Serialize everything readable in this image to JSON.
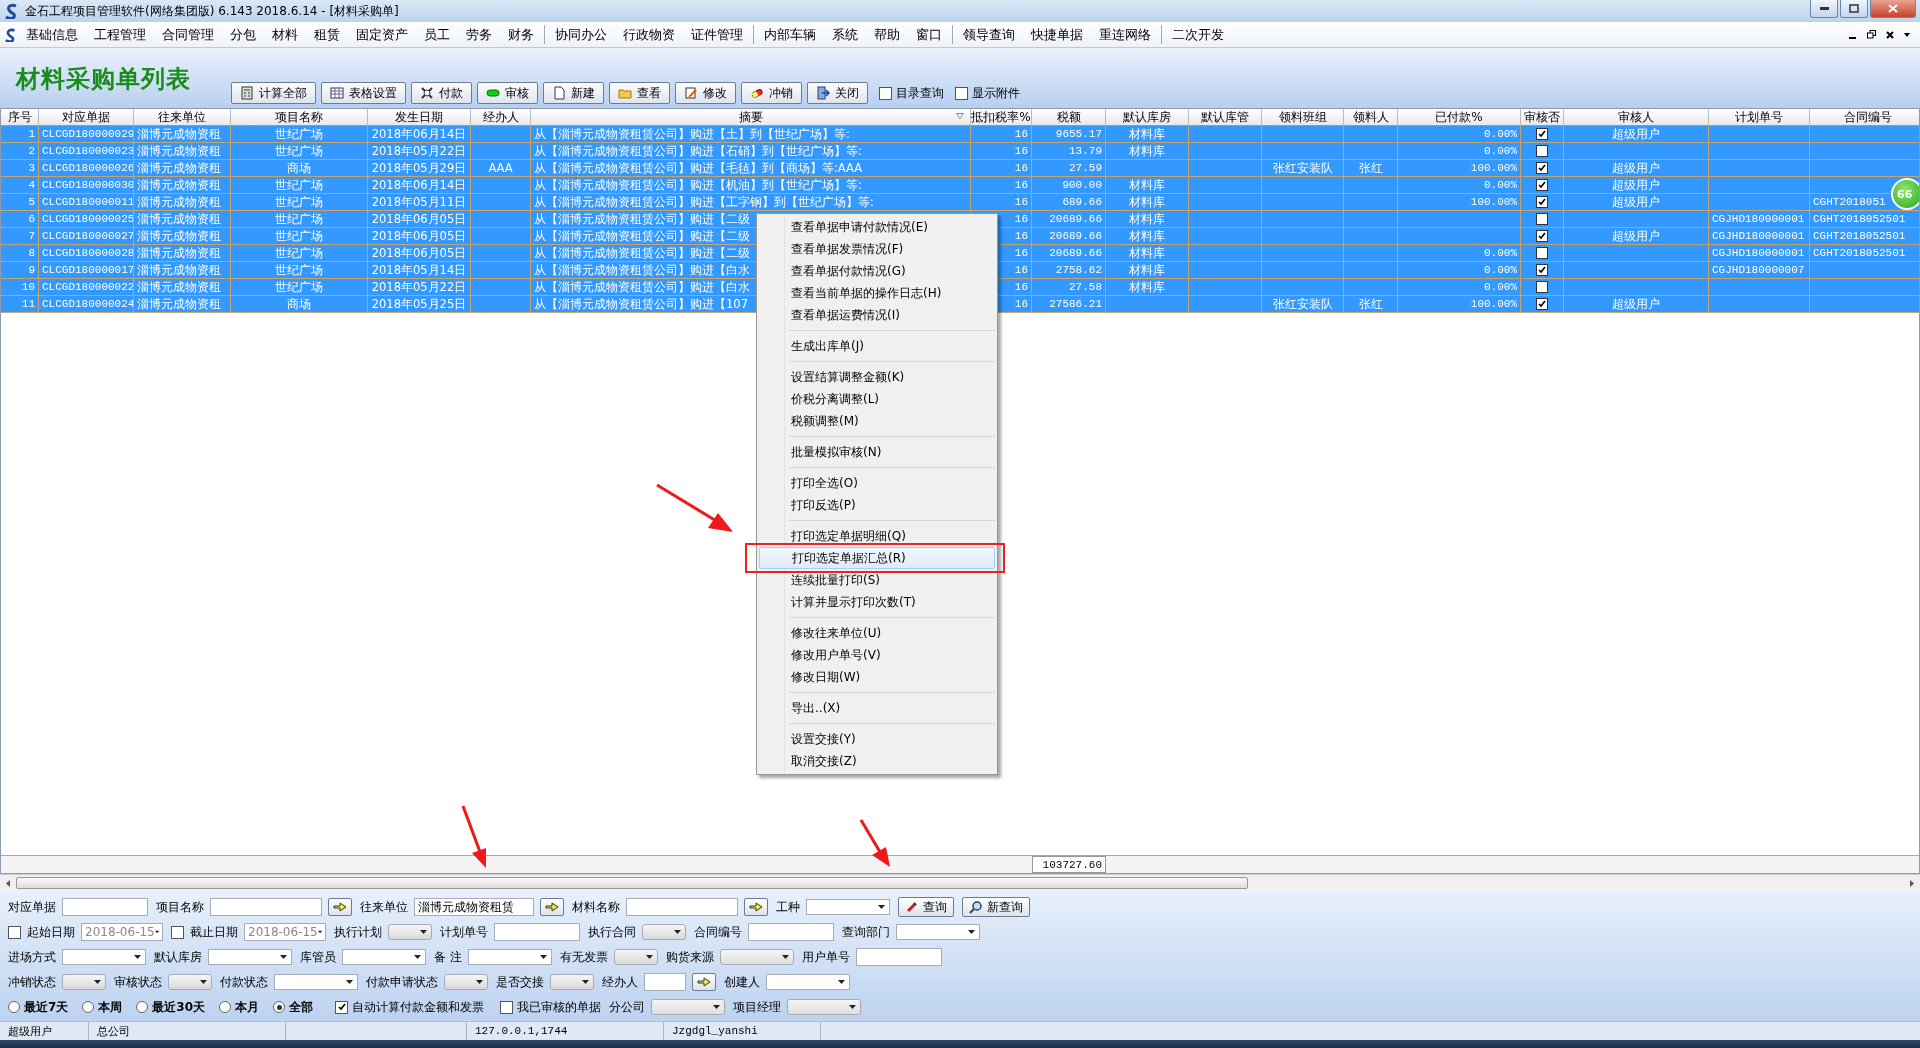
{
  "window": {
    "title": "金石工程项目管理软件(网络集团版) 6.143  2018.6.14 - [材料采购单]"
  },
  "menu_groups": [
    [
      "基础信息",
      "工程管理",
      "合同管理",
      "分包",
      "材料",
      "租赁",
      "固定资产",
      "员工",
      "劳务",
      "财务"
    ],
    [
      "协同办公",
      "行政物资",
      "证件管理"
    ],
    [
      "内部车辆",
      "系统",
      "帮助",
      "窗口"
    ],
    [
      "领导查询",
      "快捷单据",
      "重连网络"
    ],
    [
      "二次开发"
    ]
  ],
  "page_title": "材料采购单列表",
  "toolbar": [
    {
      "label": "计算全部"
    },
    {
      "label": "表格设置"
    },
    {
      "label": "付款"
    },
    {
      "label": "审核"
    },
    {
      "label": "新建"
    },
    {
      "label": "查看"
    },
    {
      "label": "修改"
    },
    {
      "label": "冲销"
    },
    {
      "label": "关闭"
    }
  ],
  "toolbar_checks": [
    {
      "label": "目录查询",
      "checked": false
    },
    {
      "label": "显示附件",
      "checked": false
    }
  ],
  "table": {
    "columns": [
      "序号",
      "对应单据",
      "往来单位",
      "项目名称",
      "发生日期",
      "经办人",
      "摘要",
      "抵扣税率%",
      "税额",
      "默认库房",
      "默认库管",
      "领料班组",
      "领料人",
      "已付款%",
      "审核否",
      "审核人",
      "计划单号",
      "合同编号"
    ],
    "rows": [
      {
        "no": "1",
        "doc": "CLCGD180000029",
        "partner": "淄博元成物资租",
        "project": "世纪广场",
        "date": "2018年06月14日",
        "summary": "从【淄博元成物资租赁公司】购进【土】到【世纪广场】等:",
        "rate": "16",
        "tax": "9655.17",
        "warehouse": "材料库",
        "paid": "0.00%",
        "approved": true,
        "approver": "超级用户",
        "selected": true
      },
      {
        "no": "2",
        "doc": "CLCGD180000023",
        "partner": "淄博元成物资租",
        "project": "世纪广场",
        "date": "2018年05月22日",
        "summary": "从【淄博元成物资租赁公司】购进【石硝】到【世纪广场】等:",
        "rate": "16",
        "tax": "13.79",
        "warehouse": "材料库",
        "paid": "0.00%",
        "approved": false,
        "selected": true
      },
      {
        "no": "3",
        "doc": "CLCGD180000026",
        "partner": "淄博元成物资租",
        "project": "商场",
        "date": "2018年05月29日",
        "handler": "AAA",
        "summary": "从【淄博元成物资租赁公司】购进【毛毡】到【商场】等:AAA",
        "rate": "16",
        "tax": "27.59",
        "team": "张红安装队",
        "receiver": "张红",
        "paid": "100.00%",
        "approved": true,
        "approver": "超级用户",
        "selected": true
      },
      {
        "no": "4",
        "doc": "CLCGD180000030",
        "partner": "淄博元成物资租",
        "project": "世纪广场",
        "date": "2018年06月14日",
        "summary": "从【淄博元成物资租赁公司】购进【机油】到【世纪广场】等:",
        "rate": "16",
        "tax": "900.00",
        "warehouse": "材料库",
        "paid": "0.00%",
        "approved": true,
        "approver": "超级用户",
        "selected": true
      },
      {
        "no": "5",
        "doc": "CLCGD180000011",
        "partner": "淄博元成物资租",
        "project": "世纪广场",
        "date": "2018年05月11日",
        "summary": "从【淄博元成物资租赁公司】购进【工字钢】到【世纪广场】等:",
        "rate": "16",
        "tax": "689.66",
        "warehouse": "材料库",
        "paid": "100.00%",
        "approved": true,
        "approver": "超级用户",
        "contract": "CGHT2018051",
        "selected": true
      },
      {
        "no": "6",
        "doc": "CLCGD180000025",
        "partner": "淄博元成物资租",
        "project": "世纪广场",
        "date": "2018年06月05日",
        "summary": "从【淄博元成物资租赁公司】购进【二级",
        "rate": "16",
        "tax": "20689.66",
        "warehouse": "材料库",
        "approved": false,
        "plan": "CGJHD180000001",
        "contract": "CGHT2018052501",
        "selected": true
      },
      {
        "no": "7",
        "doc": "CLCGD180000027",
        "partner": "淄博元成物资租",
        "project": "世纪广场",
        "date": "2018年06月05日",
        "summary": "从【淄博元成物资租赁公司】购进【二级",
        "rate": "16",
        "tax": "20689.66",
        "warehouse": "材料库",
        "approved": true,
        "approver": "超级用户",
        "plan": "CGJHD180000001",
        "contract": "CGHT2018052501",
        "selected": true
      },
      {
        "no": "8",
        "doc": "CLCGD180000028",
        "partner": "淄博元成物资租",
        "project": "世纪广场",
        "date": "2018年06月05日",
        "summary": "从【淄博元成物资租赁公司】购进【二级",
        "rate": "16",
        "tax": "20689.66",
        "warehouse": "材料库",
        "paid": "0.00%",
        "approved": false,
        "plan": "CGJHD180000001",
        "contract": "CGHT2018052501",
        "selected": true
      },
      {
        "no": "9",
        "doc": "CLCGD180000017",
        "partner": "淄博元成物资租",
        "project": "世纪广场",
        "date": "2018年05月14日",
        "summary": "从【淄博元成物资租赁公司】购进【白水",
        "rate": "16",
        "tax": "2758.62",
        "warehouse": "材料库",
        "paid": "0.00%",
        "approved": true,
        "plan": "CGJHD180000007",
        "selected": true
      },
      {
        "no": "10",
        "doc": "CLCGD180000022",
        "partner": "淄博元成物资租",
        "project": "世纪广场",
        "date": "2018年05月22日",
        "summary": "从【淄博元成物资租赁公司】购进【白水",
        "rate": "16",
        "tax": "27.58",
        "warehouse": "材料库",
        "paid": "0.00%",
        "approved": false,
        "selected": true
      },
      {
        "no": "11",
        "doc": "CLCGD180000024",
        "partner": "淄博元成物资租",
        "project": "商场",
        "date": "2018年05月25日",
        "summary": "从【淄博元成物资租赁公司】购进【107",
        "rate": "16",
        "tax": "27586.21",
        "team": "张红安装队",
        "receiver": "张红",
        "paid": "100.00%",
        "approved": true,
        "approver": "超级用户",
        "selected": true
      }
    ],
    "total_tax": "103727.60"
  },
  "floating_badge": "66",
  "context_menu": [
    [
      {
        "label": "查看单据申请付款情况(E)",
        "selected": false
      },
      {
        "label": "查看单据发票情况(F)",
        "selected": false
      },
      {
        "label": "查看单据付款情况(G)",
        "selected": false
      },
      {
        "label": "查看当前单据的操作日志(H)",
        "selected": false
      },
      {
        "label": "查看单据运费情况(I)",
        "selected": false
      }
    ],
    [
      {
        "label": "生成出库单(J)",
        "selected": false
      }
    ],
    [
      {
        "label": "设置结算调整金额(K)",
        "selected": false
      },
      {
        "label": "价税分离调整(L)",
        "selected": false
      },
      {
        "label": "税额调整(M)",
        "selected": false
      }
    ],
    [
      {
        "label": "批量模拟审核(N)",
        "selected": false
      }
    ],
    [
      {
        "label": "打印全选(O)",
        "selected": false
      },
      {
        "label": "打印反选(P)",
        "selected": false
      }
    ],
    [
      {
        "label": "打印选定单据明细(Q)",
        "selected": false
      },
      {
        "label": "打印选定单据汇总(R)",
        "selected": true,
        "callout": true
      },
      {
        "label": "连续批量打印(S)",
        "selected": false
      },
      {
        "label": "计算并显示打印次数(T)",
        "selected": false
      }
    ],
    [
      {
        "label": "修改往来单位(U)",
        "selected": false
      },
      {
        "label": "修改用户单号(V)",
        "selected": false
      },
      {
        "label": "修改日期(W)",
        "selected": false
      }
    ],
    [
      {
        "label": "导出..(X)",
        "selected": false
      }
    ],
    [
      {
        "label": "设置交接(Y)",
        "selected": false
      },
      {
        "label": "取消交接(Z)",
        "selected": false
      }
    ]
  ],
  "filter_rows": [
    [
      {
        "kind": "text",
        "label": "对应单据"
      },
      {
        "kind": "lookup",
        "label": "项目名称"
      },
      {
        "kind": "lookup",
        "label": "往来单位",
        "value": "淄博元成物资租赁"
      },
      {
        "kind": "lookup",
        "label": "材料名称"
      },
      {
        "kind": "select",
        "label": "工种"
      },
      {
        "kind": "button",
        "label": "查询"
      },
      {
        "kind": "button",
        "label": "新查询"
      }
    ],
    [
      {
        "kind": "date",
        "label": "起始日期",
        "value": "2018-06-15",
        "checked": false
      },
      {
        "kind": "date",
        "label": "截止日期",
        "value": "2018-06-15",
        "checked": false
      },
      {
        "kind": "select-short",
        "label": "执行计划"
      },
      {
        "kind": "text",
        "label": "计划单号"
      },
      {
        "kind": "select-short",
        "label": "执行合同"
      },
      {
        "kind": "text",
        "label": "合同编号"
      },
      {
        "kind": "select",
        "label": "查询部门"
      }
    ],
    [
      {
        "kind": "select",
        "label": "进场方式"
      },
      {
        "kind": "select",
        "label": "默认库房"
      },
      {
        "kind": "select",
        "label": "库管员"
      },
      {
        "kind": "select",
        "label": "备  注"
      },
      {
        "kind": "select-short",
        "label": "有无发票"
      },
      {
        "kind": "select-disabled",
        "label": "购货来源"
      },
      {
        "kind": "text",
        "label": "用户单号"
      }
    ],
    [
      {
        "kind": "select-short",
        "label": "冲销状态"
      },
      {
        "kind": "select-short",
        "label": "审核状态"
      },
      {
        "kind": "select",
        "label": "付款状态"
      },
      {
        "kind": "select-short",
        "label": "付款申请状态"
      },
      {
        "kind": "select-short",
        "label": "是否交接"
      },
      {
        "kind": "lookup-short",
        "label": "经办人"
      },
      {
        "kind": "select",
        "label": "创建人"
      }
    ],
    [
      {
        "kind": "radio",
        "label": "最近7天",
        "selected": false
      },
      {
        "kind": "radio",
        "label": "本周",
        "selected": false
      },
      {
        "kind": "radio",
        "label": "最近30天",
        "selected": false
      },
      {
        "kind": "radio",
        "label": "本月",
        "selected": false
      },
      {
        "kind": "radio",
        "label": "全部",
        "selected": true
      },
      {
        "kind": "check",
        "label": "自动计算付款金额和发票",
        "checked": true
      },
      {
        "kind": "check",
        "label": "我已审核的单据",
        "checked": false
      },
      {
        "kind": "select-disabled",
        "label": "分公司"
      },
      {
        "kind": "select-disabled",
        "label": "项目经理"
      }
    ]
  ],
  "status_bar": [
    "超级用户",
    "总公司",
    "127.0.0.1,1744",
    "Jzgdgl_yanshi"
  ]
}
